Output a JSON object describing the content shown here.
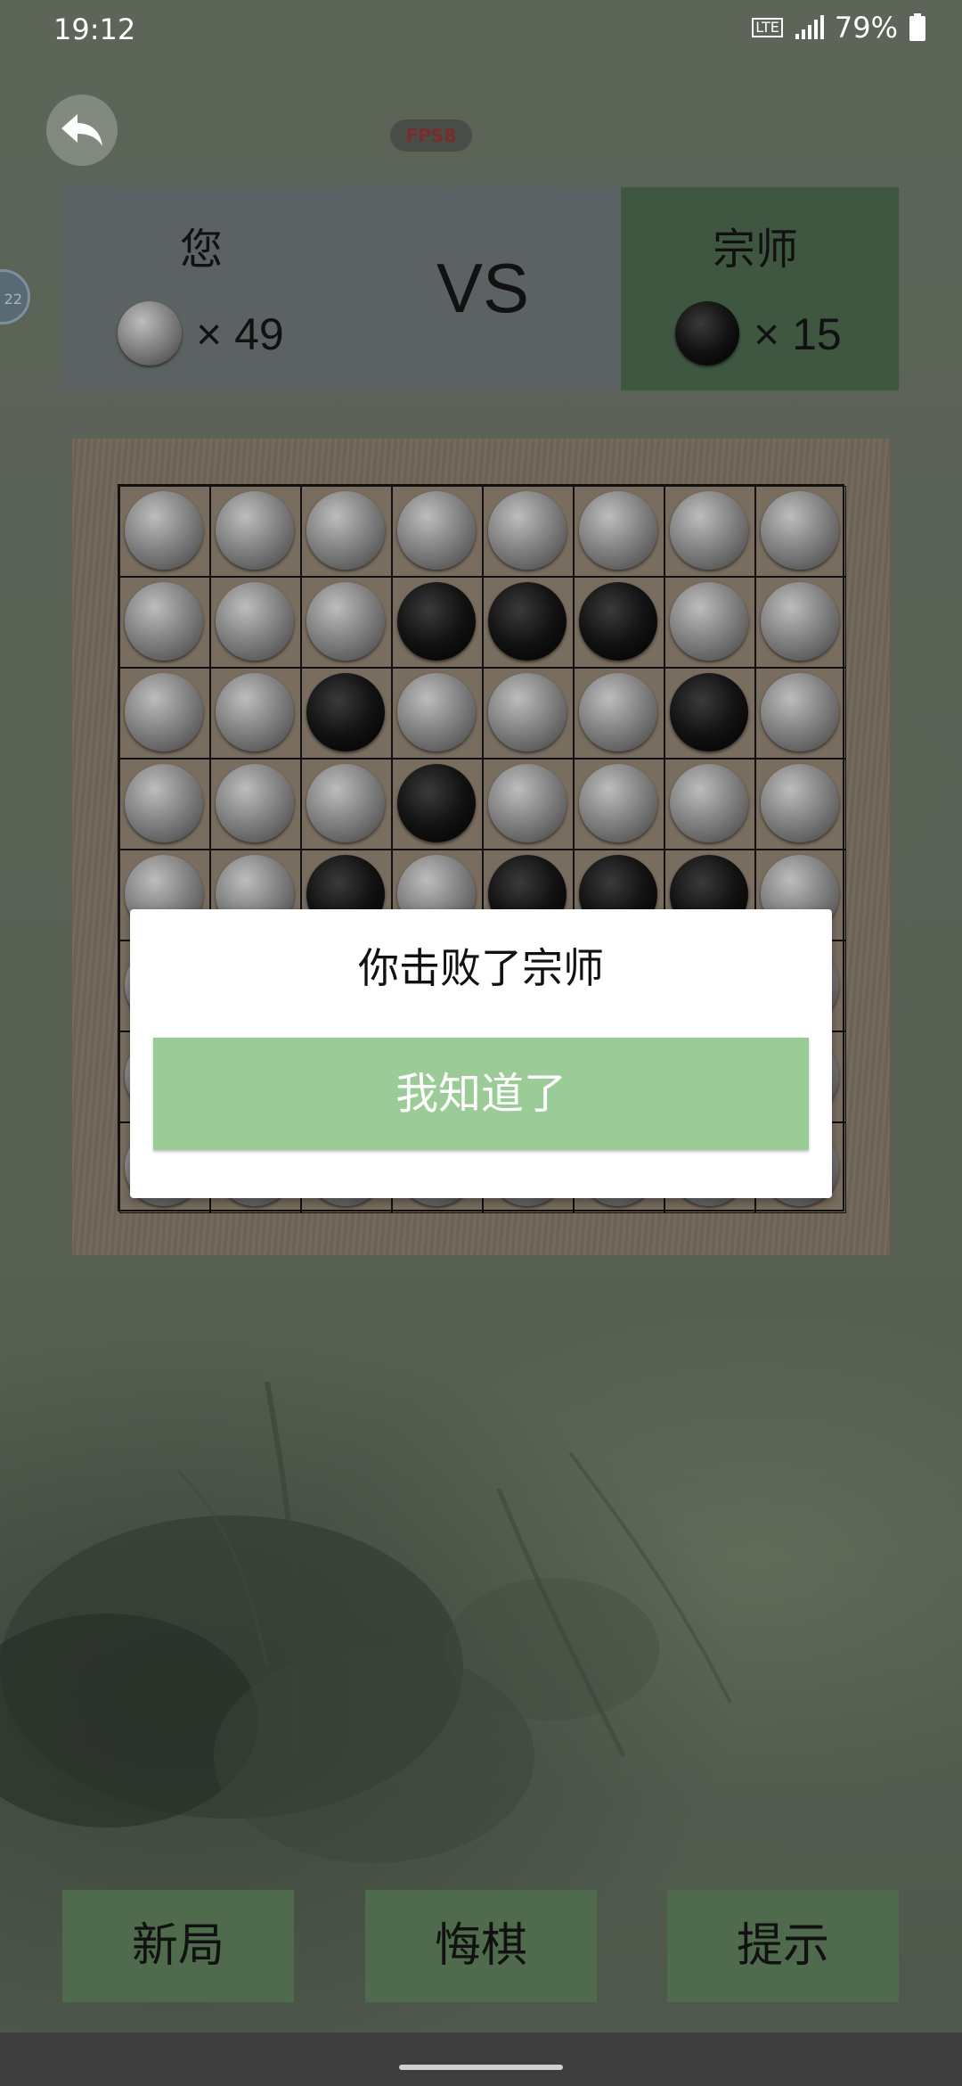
{
  "status_bar": {
    "time": "19:12",
    "network": "LTE",
    "battery": "79%"
  },
  "header": {
    "fps_badge": "FPS8"
  },
  "score": {
    "player_name": "您",
    "player_count": "× 49",
    "vs": "VS",
    "opponent_name": "宗师",
    "opponent_count": "× 15"
  },
  "board": {
    "size": 8,
    "rows": [
      [
        "G",
        "G",
        "G",
        "G",
        "G",
        "G",
        "G",
        "G"
      ],
      [
        "G",
        "G",
        "G",
        "B",
        "B",
        "B",
        "G",
        "G"
      ],
      [
        "G",
        "G",
        "B",
        "G",
        "G",
        "G",
        "B",
        "G"
      ],
      [
        "G",
        "G",
        "G",
        "B",
        "G",
        "G",
        "G",
        "G"
      ],
      [
        "G",
        "G",
        "B",
        "G",
        "B",
        "B",
        "B",
        "G"
      ],
      [
        "G",
        "G",
        "G",
        "G",
        "G",
        "G",
        "G",
        "G"
      ],
      [
        "G",
        "G",
        "G",
        "G",
        "G",
        "G",
        "G",
        "G"
      ],
      [
        "G",
        "G",
        "G",
        "G",
        "G",
        "G",
        "G",
        "G"
      ]
    ]
  },
  "dialog": {
    "title": "你击败了宗师",
    "confirm_label": "我知道了"
  },
  "controls": {
    "new_game": "新局",
    "undo": "悔棋",
    "hint": "提示"
  },
  "colors": {
    "player_panel": "#5c6263",
    "opponent_panel": "#3f5741",
    "dialog_button": "#9bcc97",
    "bottom_button": "#4f6a4c"
  }
}
